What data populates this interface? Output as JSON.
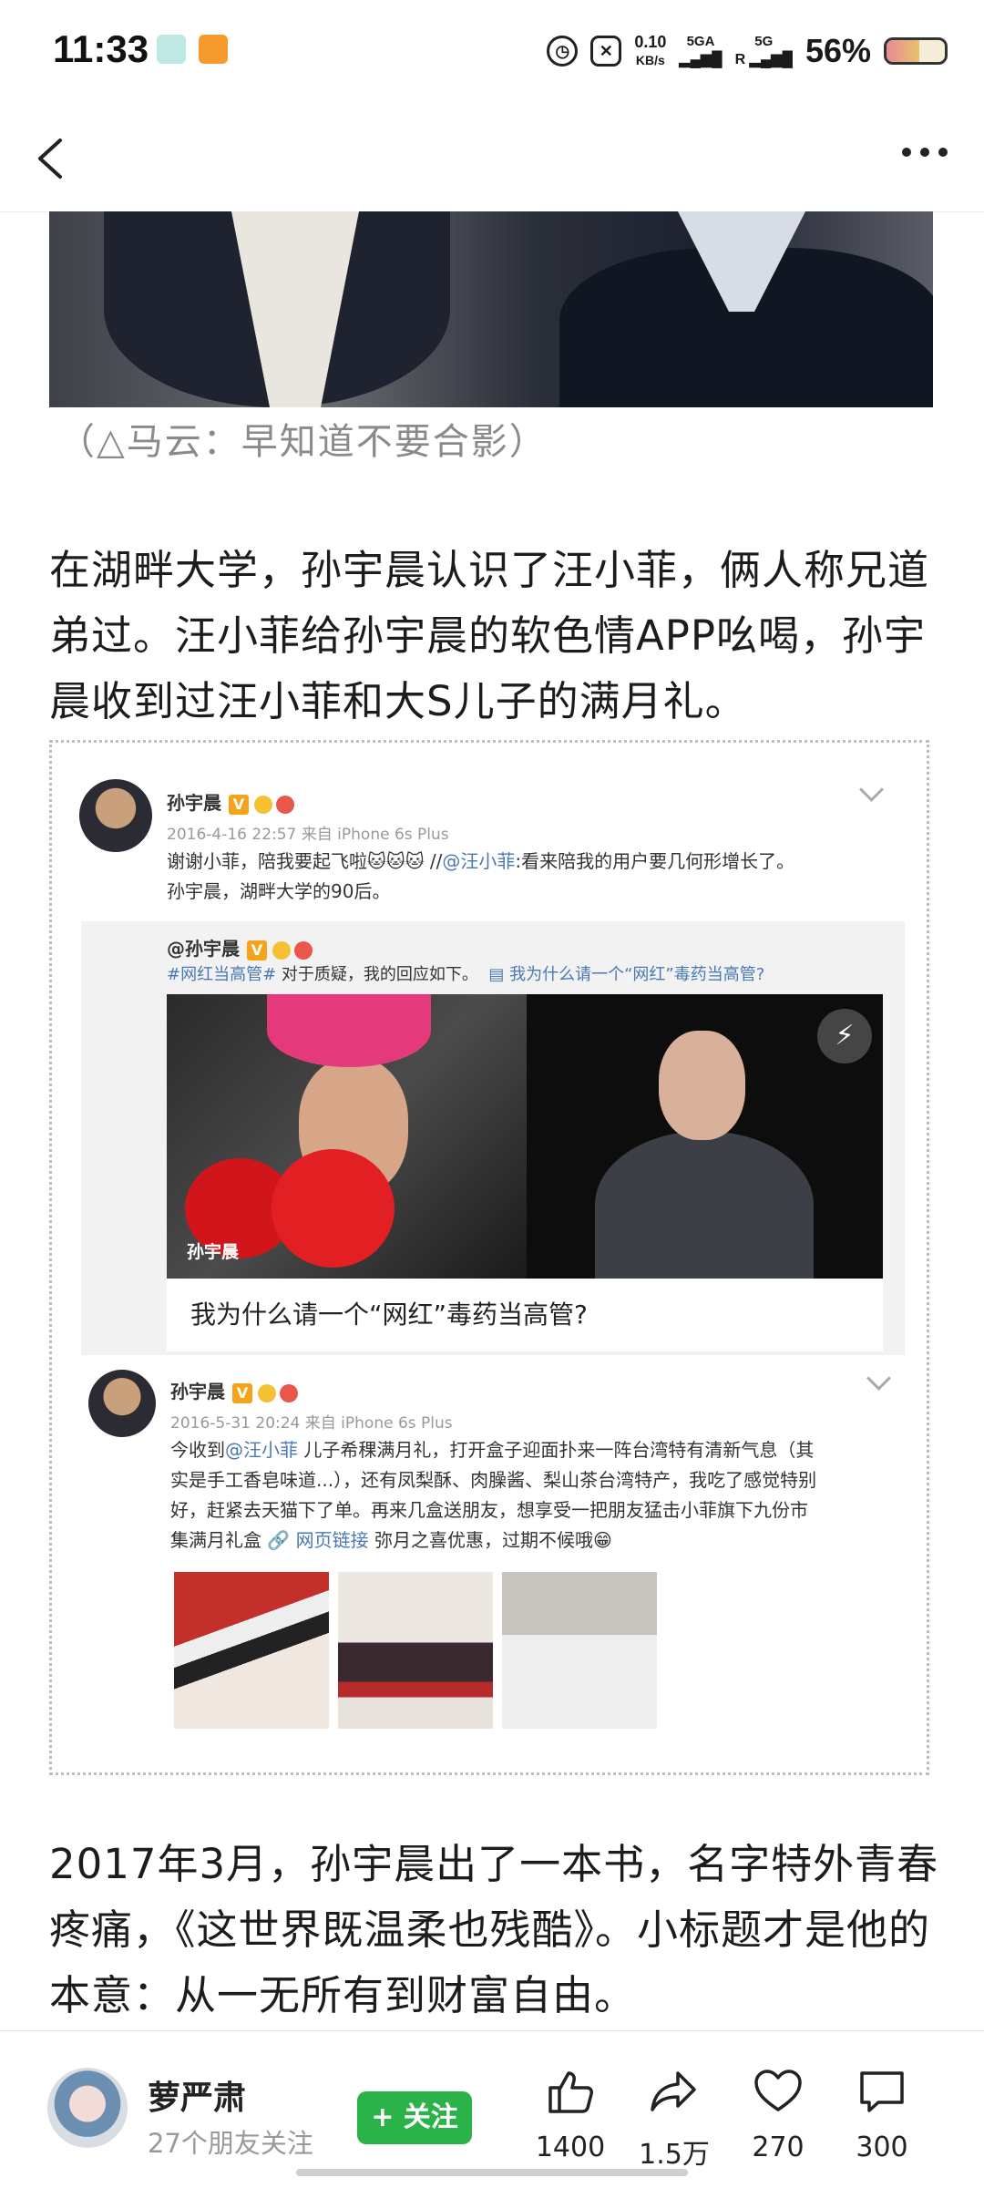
{
  "status_bar": {
    "time": "11:33",
    "net_speed_value": "0.10",
    "net_speed_unit": "KB/s",
    "signal_1": "5GA",
    "signal_2": "5G",
    "signal_2_sub": "R",
    "battery_text": "56%",
    "battery_level": 0.56
  },
  "article": {
    "photo_caption": "（△马云：早知道不要合影）",
    "para1": "在湖畔大学，孙宇晨认识了汪小菲，俩人称兄道弟过。汪小菲给孙宇晨的软色情APP吆喝，孙宇晨收到过汪小菲和大S儿子的满月礼。",
    "para2": "2017年3月，孙宇晨出了一本书，名字特外青春疼痛，《这世界既温柔也残酷》。小标题才是他的本意：从一无所有到财富自由。"
  },
  "embed": {
    "post1": {
      "name": "孙宇晨",
      "meta": "2016-4-16 22:57 来自 iPhone 6s Plus",
      "text_a": "谢谢小菲，陪我要起飞啦🐱🐱🐱 //",
      "mention": "@汪小菲",
      "text_b": ":看来陪我的用户要几何形增长了。",
      "text_c": "孙宇晨，湖畔大学的90后。"
    },
    "repost": {
      "name": "@孙宇晨",
      "hashtag": "#网红当高管#",
      "text": " 对于质疑，我的回应如下。",
      "link": "▤ 我为什么请一个“网红”毒药当高管?",
      "cover_tag": "孙宇晨",
      "cover_title": "我为什么请一个“网红”毒药当高管?"
    },
    "post2": {
      "name": "孙宇晨",
      "meta": "2016-5-31 20:24 来自 iPhone 6s Plus",
      "line1_a": "今收到",
      "line1_mention": "@汪小菲",
      "line1_b": " 儿子希稞满月礼，打开盒子迎面扑来一阵台湾特有清新气息（其",
      "line2": "实是手工香皂味道...），还有凤梨酥、肉臊酱、梨山茶台湾特产，我吃了感觉特别",
      "line3": "好，赶紧去天猫下了单。再来几盒送朋友，想享受一把朋友猛击小菲旗下九份市",
      "line4_a": "集满月礼盒  ",
      "line4_link": "🔗 网页链接",
      "line4_b": " 弥月之喜优惠，过期不候哦😁"
    }
  },
  "bottom_bar": {
    "username": "萝严肃",
    "subtitle": "27个朋友关注",
    "follow_label": "+ 关注",
    "like_count": "1400",
    "share_count": "1.5万",
    "fav_count": "270",
    "comment_count": "300"
  },
  "colors": {
    "follow_green": "#2bb34a",
    "weibo_link": "#4a78b3",
    "vip_orange": "#f4a31a"
  },
  "icons": [
    "back-arrow-icon",
    "more-dots-icon",
    "like-icon",
    "share-icon",
    "favorite-icon",
    "comment-icon",
    "chevron-down-icon",
    "play-icon"
  ]
}
